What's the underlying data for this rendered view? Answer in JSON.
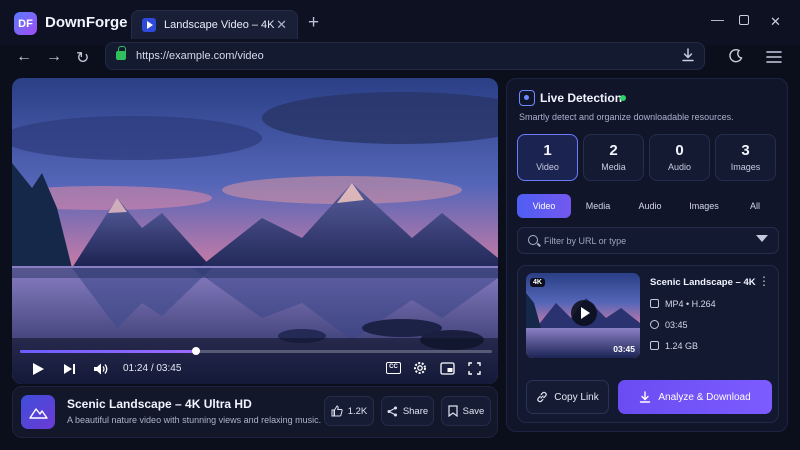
{
  "app": {
    "logo_text": "DF",
    "name": "DownForge"
  },
  "tab": {
    "title": "Landscape Video – 4K"
  },
  "address": {
    "url": "https://example.com/video"
  },
  "player": {
    "current_time": "01:24",
    "duration": "03:45",
    "progress_fraction": 0.373
  },
  "info": {
    "title": "Scenic Landscape – 4K Ultra HD",
    "description": "A beautiful nature video with stunning views and relaxing music.",
    "likes": "1.2K",
    "share_label": "Share",
    "save_label": "Save"
  },
  "panel": {
    "title": "Live Detection",
    "subtitle": "Smartly detect and organize downloadable resources.",
    "stats": [
      {
        "count": "1",
        "label": "Video"
      },
      {
        "count": "2",
        "label": "Media"
      },
      {
        "count": "0",
        "label": "Audio"
      },
      {
        "count": "3",
        "label": "Images"
      }
    ],
    "filters": [
      "Video",
      "Media",
      "Audio",
      "Images",
      "All"
    ],
    "search_placeholder": "Filter by URL or type",
    "item": {
      "badge": "4K",
      "duration": "03:45",
      "title": "Scenic Landscape – 4K",
      "format": "MP4 • H.264",
      "length": "03:45",
      "size": "1.24 GB"
    },
    "copy_label": "Copy Link",
    "download_label": "Analyze & Download"
  },
  "colors": {
    "accent": "#6b5cff",
    "live": "#2fd067",
    "secure": "#2fbf5c"
  }
}
